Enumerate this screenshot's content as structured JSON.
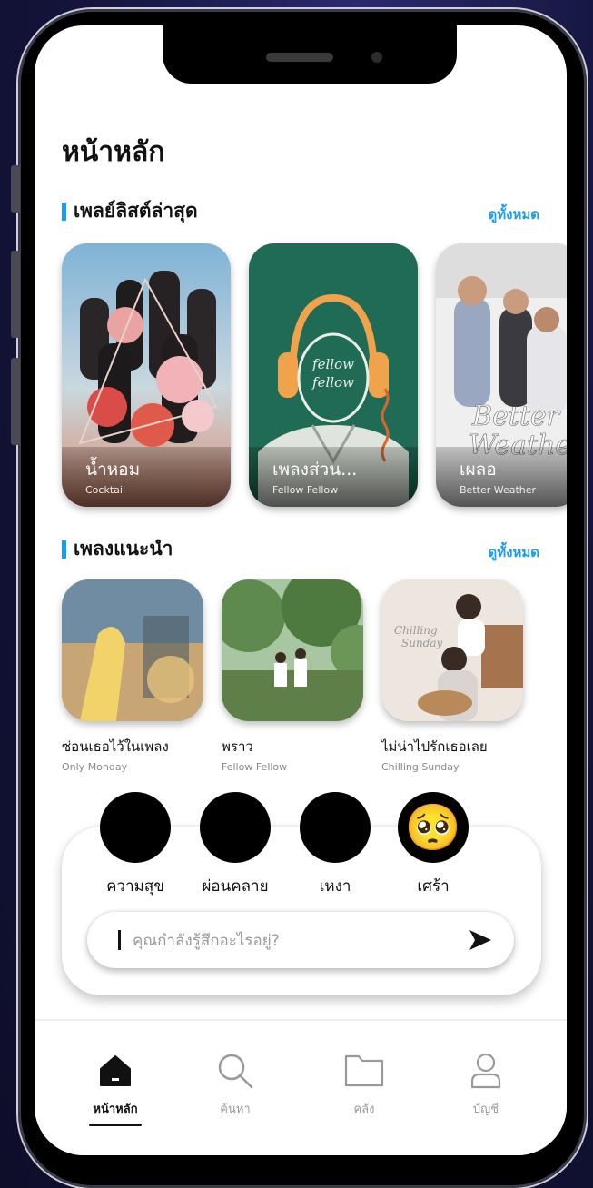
{
  "page": {
    "title": "หน้าหลัก"
  },
  "latest_playlists": {
    "heading": "เพลย์ลิสต์ล่าสุด",
    "see_all": "ดูทั้งหมด",
    "items": [
      {
        "name": "น้ำหอม",
        "artist": "Cocktail"
      },
      {
        "name": "เพลงส่วน...",
        "artist": "Fellow Fellow"
      },
      {
        "name": "เผลอ",
        "artist": "Better Weather"
      }
    ]
  },
  "recommended": {
    "heading": "เพลงแนะนำ",
    "see_all": "ดูทั้งหมด",
    "items": [
      {
        "title": "ซ่อนเธอไว้ในเพลง",
        "artist": "Only Monday"
      },
      {
        "title": "พราว",
        "artist": "Fellow Fellow"
      },
      {
        "title": "ไม่น่าไปรักเธอเลย",
        "artist": "Chilling Sunday"
      }
    ]
  },
  "moods": [
    {
      "label": "ความสุข",
      "emoji": "😀",
      "icon": "happy-face-icon"
    },
    {
      "label": "ผ่อนคลาย",
      "emoji": "😙",
      "icon": "relaxed-face-icon"
    },
    {
      "label": "เหงา",
      "emoji": "😒",
      "icon": "unamused-face-icon"
    },
    {
      "label": "เศร้า",
      "emoji": "🥺",
      "icon": "pleading-face-icon"
    }
  ],
  "mood_input": {
    "placeholder": "คุณกำลังรู้สึกอะไรอยู่?",
    "value": ""
  },
  "tabs": [
    {
      "label": "หน้าหลัก",
      "icon": "home-icon",
      "active": true
    },
    {
      "label": "ค้นหา",
      "icon": "search-icon",
      "active": false
    },
    {
      "label": "คลัง",
      "icon": "folder-icon",
      "active": false
    },
    {
      "label": "บัญชี",
      "icon": "user-icon",
      "active": false
    }
  ],
  "colors": {
    "accent": "#1a9cf0",
    "text": "#111111",
    "muted": "#888888"
  }
}
